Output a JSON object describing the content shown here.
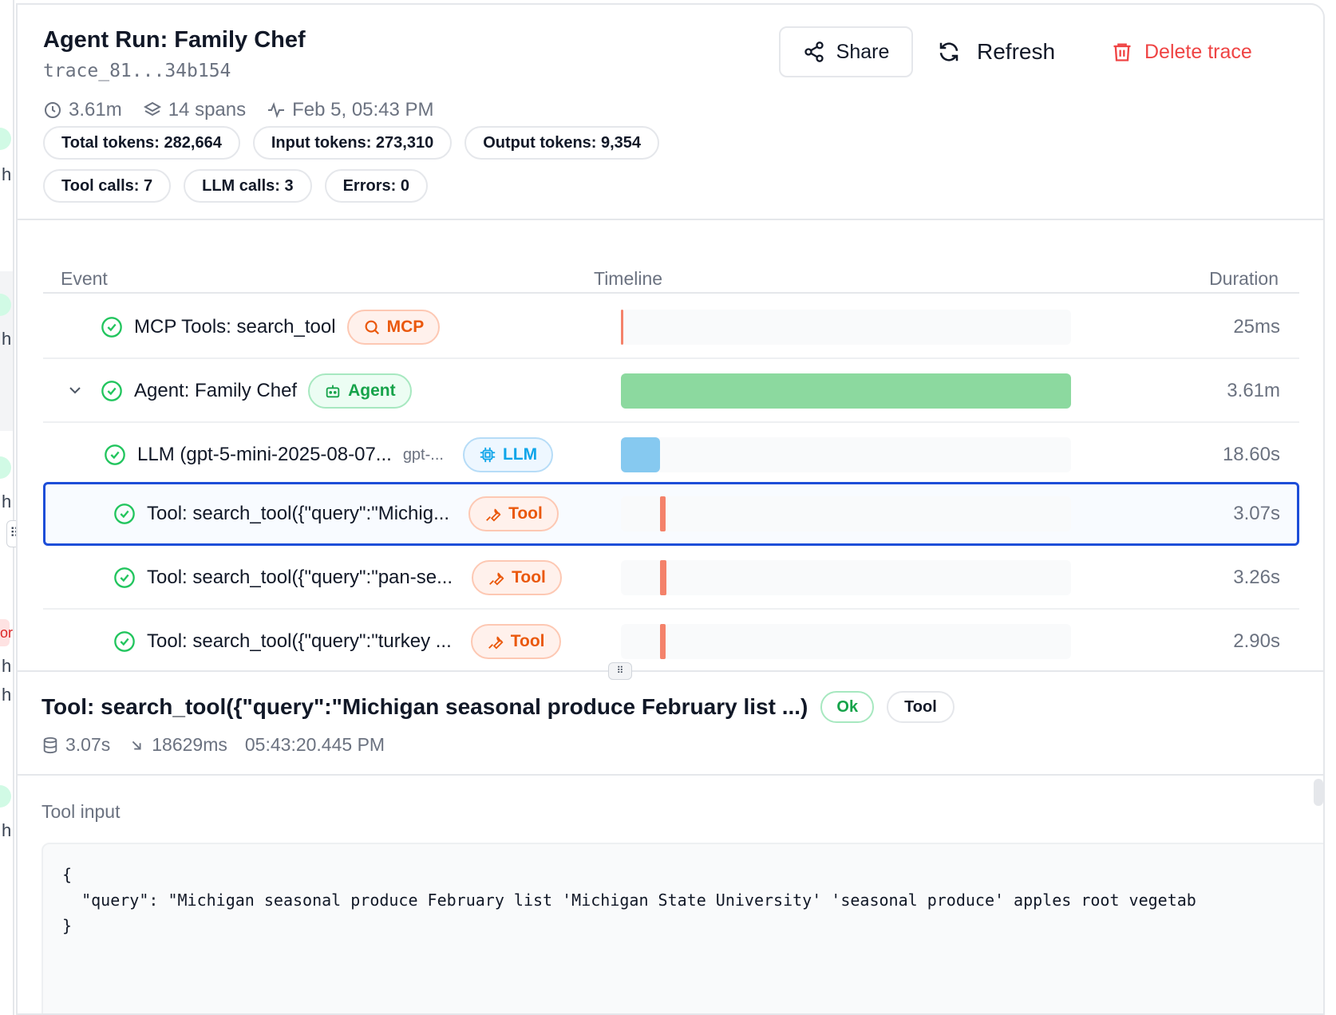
{
  "header": {
    "title": "Agent Run: Family Chef",
    "trace_id": "trace_81...34b154",
    "duration": "3.61m",
    "spans": "14 spans",
    "date": "Feb 5, 05:43 PM",
    "share_label": "Share",
    "refresh_label": "Refresh",
    "delete_label": "Delete trace"
  },
  "stats": {
    "total_tokens": "Total tokens: 282,664",
    "input_tokens": "Input tokens: 273,310",
    "output_tokens": "Output tokens: 9,354",
    "tool_calls": "Tool calls: 7",
    "llm_calls": "LLM calls: 3",
    "errors": "Errors: 0"
  },
  "table": {
    "columns": [
      "Event",
      "Timeline",
      "Duration"
    ],
    "rows": [
      {
        "name": "MCP Tools: search_tool",
        "tag": "MCP",
        "duration": "25ms",
        "timeline_start": 0.0,
        "timeline_width": 0.005
      },
      {
        "name": "Agent: Family Chef",
        "tag": "Agent",
        "duration": "3.61m",
        "timeline_start": 0.0,
        "timeline_width": 1.0
      },
      {
        "name": "LLM (gpt-5-mini-2025-08-07...",
        "sub": "gpt-...",
        "tag": "LLM",
        "duration": "18.60s",
        "timeline_start": 0.0,
        "timeline_width": 0.086
      },
      {
        "name": "Tool: search_tool({\"query\":\"Michig...",
        "tag": "Tool",
        "duration": "3.07s",
        "timeline_start": 0.086,
        "timeline_width": 0.014
      },
      {
        "name": "Tool: search_tool({\"query\":\"pan-se...",
        "tag": "Tool",
        "duration": "3.26s",
        "timeline_start": 0.086,
        "timeline_width": 0.015
      },
      {
        "name": "Tool: search_tool({\"query\":\"turkey ...",
        "tag": "Tool",
        "duration": "2.90s",
        "timeline_start": 0.086,
        "timeline_width": 0.013
      }
    ]
  },
  "colors": {
    "mcp": "#f4826a",
    "agent": "#8cd99f",
    "llm": "#86c9f0",
    "tool": "#f4826a",
    "selected": "#1d4ed8"
  },
  "detail": {
    "title": "Tool: search_tool({\"query\":\"Michigan seasonal produce February list ...)",
    "status": "Ok",
    "type": "Tool",
    "duration": "3.07s",
    "offset": "18629ms",
    "timestamp": "05:43:20.445 PM",
    "section_label": "Tool input",
    "code_line1": "{",
    "code_line2": "  \"query\": \"Michigan seasonal produce February list 'Michigan State University' 'seasonal produce' apples root vegetab",
    "code_line3": "}"
  },
  "left_rail": {
    "fragments": [
      "h",
      "h",
      "h",
      "h",
      "h",
      "h",
      "or"
    ]
  }
}
